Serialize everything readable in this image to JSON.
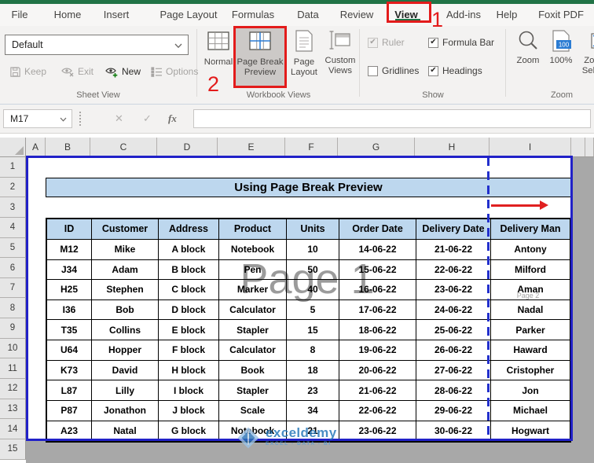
{
  "tabs": {
    "items": [
      "File",
      "Home",
      "Insert",
      "Page Layout",
      "Formulas",
      "Data",
      "Review",
      "View",
      "Add-ins",
      "Help",
      "Foxit PDF"
    ],
    "active": "View"
  },
  "annotations": {
    "step1": "1",
    "step2": "2"
  },
  "ribbon": {
    "sheet_view": {
      "dropdown_value": "Default",
      "buttons": [
        "Keep",
        "Exit",
        "New",
        "Options"
      ],
      "group_label": "Sheet View"
    },
    "workbook_views": {
      "buttons": [
        {
          "lines": [
            "Normal"
          ]
        },
        {
          "lines": [
            "Page Break",
            "Preview"
          ]
        },
        {
          "lines": [
            "Page",
            "Layout"
          ]
        },
        {
          "lines": [
            "Custom",
            "Views"
          ]
        }
      ],
      "group_label": "Workbook Views"
    },
    "show": {
      "checkboxes": [
        {
          "label": "Ruler",
          "checked": true,
          "disabled": true
        },
        {
          "label": "Formula Bar",
          "checked": true,
          "disabled": false
        },
        {
          "label": "Gridlines",
          "checked": false,
          "disabled": false
        },
        {
          "label": "Headings",
          "checked": true,
          "disabled": false
        }
      ],
      "group_label": "Show"
    },
    "zoom": {
      "buttons": [
        {
          "lines": [
            "Zoom"
          ]
        },
        {
          "lines": [
            "100%"
          ]
        },
        {
          "lines": [
            "Zoom to",
            "Selection"
          ]
        }
      ],
      "group_label": "Zoom"
    }
  },
  "formula_bar": {
    "name_box": "M17",
    "cancel_glyph": "✕",
    "enter_glyph": "✓",
    "fx_label": "fx"
  },
  "sheet": {
    "columns": [
      "A",
      "B",
      "C",
      "D",
      "E",
      "F",
      "G",
      "H",
      "I"
    ],
    "rows": [
      "1",
      "2",
      "3",
      "4",
      "5",
      "6",
      "7",
      "8",
      "9",
      "10",
      "11",
      "12",
      "13",
      "14",
      "15"
    ]
  },
  "content": {
    "title": "Using Page Break Preview",
    "table": {
      "headers": [
        "ID",
        "Customer",
        "Address",
        "Product",
        "Units",
        "Order Date",
        "Delivery Date",
        "Delivery Man"
      ],
      "rows": [
        [
          "M12",
          "Mike",
          "A block",
          "Notebook",
          "10",
          "14-06-22",
          "21-06-22",
          "Antony"
        ],
        [
          "J34",
          "Adam",
          "B block",
          "Pen",
          "50",
          "15-06-22",
          "22-06-22",
          "Milford"
        ],
        [
          "H25",
          "Stephen",
          "C block",
          "Marker",
          "40",
          "16-06-22",
          "23-06-22",
          "Aman"
        ],
        [
          "I36",
          "Bob",
          "D block",
          "Calculator",
          "5",
          "17-06-22",
          "24-06-22",
          "Nadal"
        ],
        [
          "T35",
          "Collins",
          "E block",
          "Stapler",
          "15",
          "18-06-22",
          "25-06-22",
          "Parker"
        ],
        [
          "U64",
          "Hopper",
          "F block",
          "Calculator",
          "8",
          "19-06-22",
          "26-06-22",
          "Haward"
        ],
        [
          "K73",
          "David",
          "H block",
          "Book",
          "18",
          "20-06-22",
          "27-06-22",
          "Cristopher"
        ],
        [
          "L87",
          "Lilly",
          "I block",
          "Stapler",
          "23",
          "21-06-22",
          "28-06-22",
          "Jon"
        ],
        [
          "P87",
          "Jonathon",
          "J block",
          "Scale",
          "34",
          "22-06-22",
          "29-06-22",
          "Michael"
        ],
        [
          "A23",
          "Natal",
          "G block",
          "Notebook",
          "21",
          "23-06-22",
          "30-06-22",
          "Hogwart"
        ]
      ]
    },
    "page1_watermark": "Page 1",
    "page2_watermark": "Page 2",
    "brand": {
      "name": "exceldemy",
      "tagline": "EXCEL - DATA - BI"
    }
  },
  "colors": {
    "excel_green": "#217346",
    "annotation_red": "#e31b1b",
    "page_break_blue": "#2121c8",
    "header_fill": "#bdd7ee",
    "watermark_gray": "#9b9b9b",
    "outside_gray": "#a8a8a8",
    "brand_blue": "#2175b8",
    "icon_blue": "#2b7cd3"
  }
}
